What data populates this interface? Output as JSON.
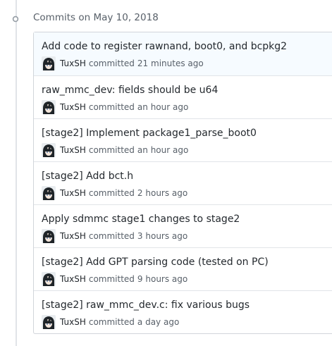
{
  "group": {
    "title": "Commits on May 10, 2018"
  },
  "commits": [
    {
      "title": "Add code to register rawnand, boot0, and bcpkg2",
      "author": "TuxSH",
      "verb": "committed",
      "time": "21 minutes ago"
    },
    {
      "title": "raw_mmc_dev: fields should be u64",
      "author": "TuxSH",
      "verb": "committed",
      "time": "an hour ago"
    },
    {
      "title": "[stage2] Implement package1_parse_boot0",
      "author": "TuxSH",
      "verb": "committed",
      "time": "an hour ago"
    },
    {
      "title": "[stage2] Add bct.h",
      "author": "TuxSH",
      "verb": "committed",
      "time": "2 hours ago"
    },
    {
      "title": "Apply sdmmc stage1 changes to stage2",
      "author": "TuxSH",
      "verb": "committed",
      "time": "3 hours ago"
    },
    {
      "title": "[stage2] Add GPT parsing code (tested on PC)",
      "author": "TuxSH",
      "verb": "committed",
      "time": "9 hours ago"
    },
    {
      "title": "[stage2] raw_mmc_dev.c: fix various bugs",
      "author": "TuxSH",
      "verb": "committed",
      "time": "a day ago"
    }
  ],
  "colors": {
    "timeline": "#e1e4e8",
    "row_highlight": "#f6fbff",
    "text_primary": "#24292e",
    "text_muted": "#586069"
  },
  "icons": {
    "group": "git-commit-icon",
    "avatar": "avatar"
  }
}
